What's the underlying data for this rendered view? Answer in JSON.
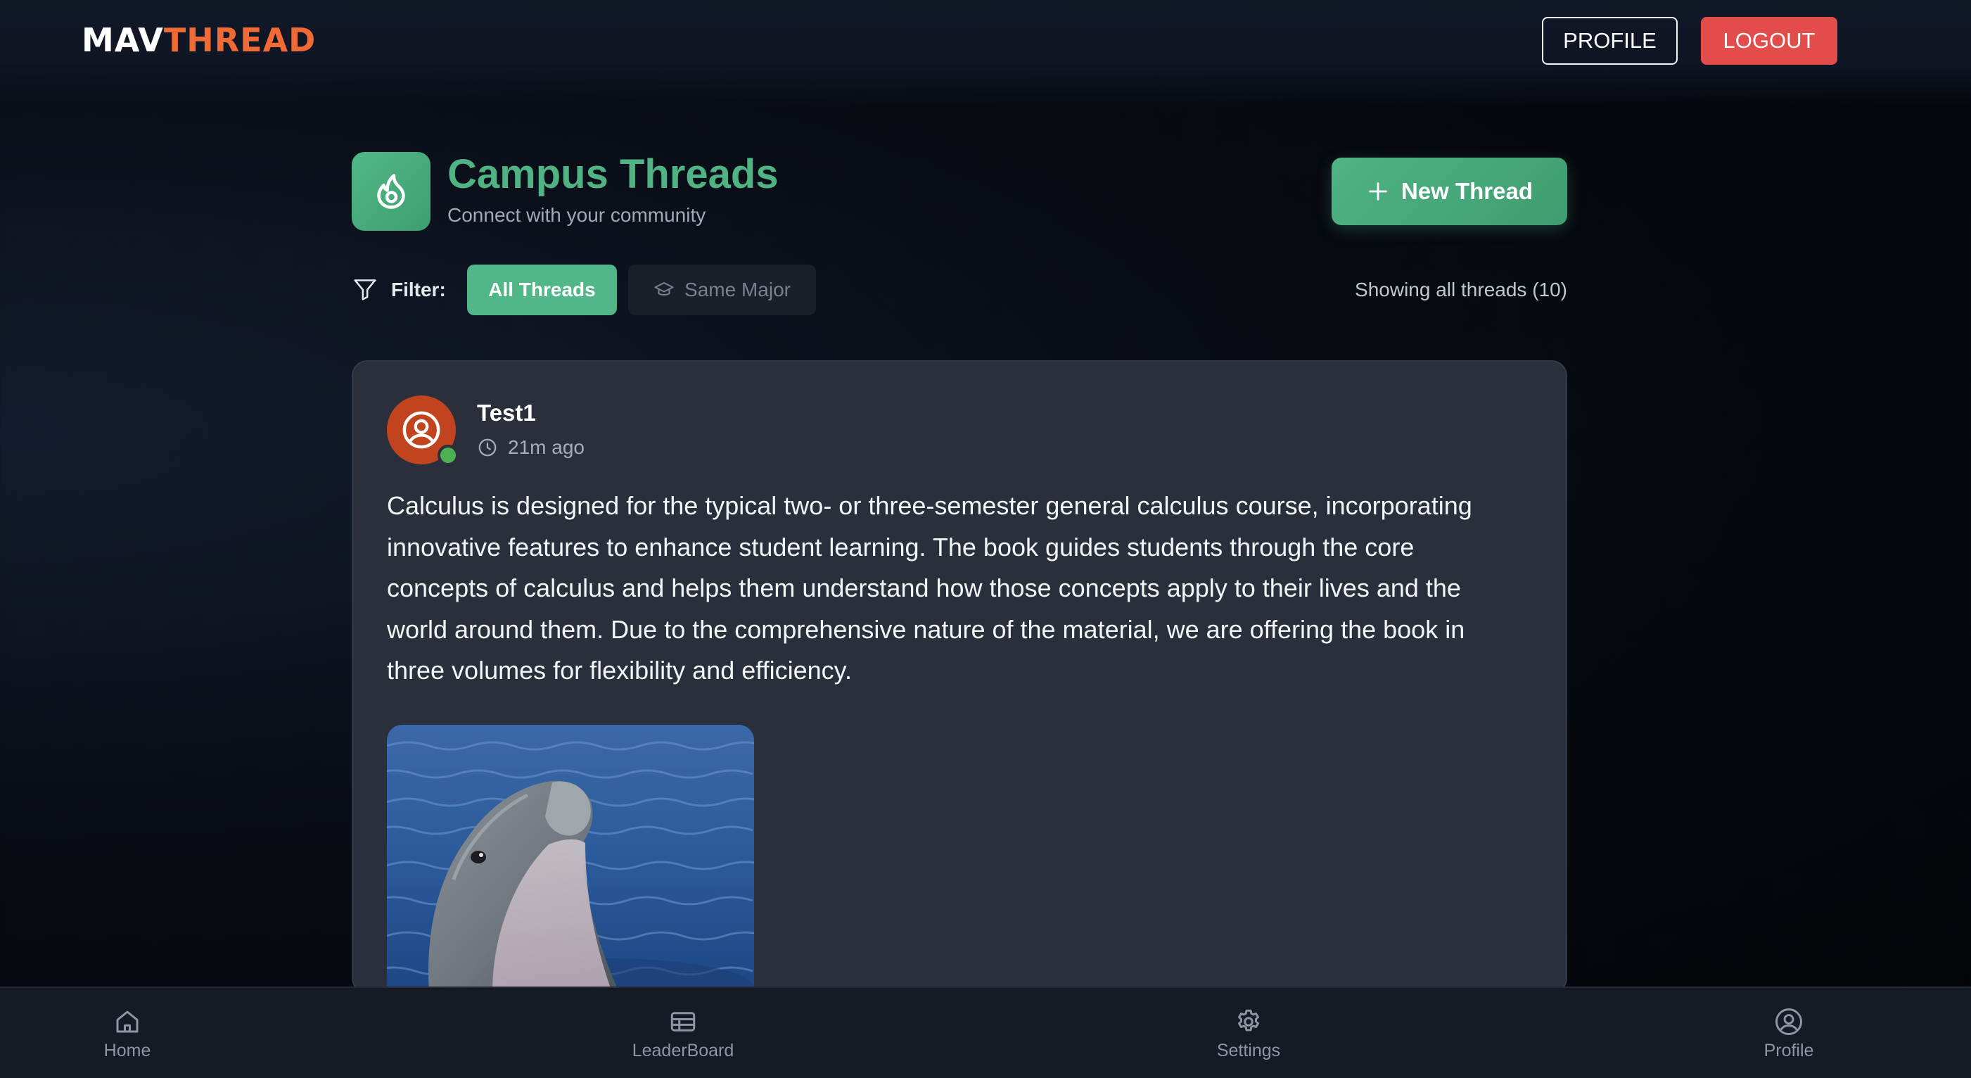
{
  "header": {
    "logo_part1": "MAV",
    "logo_part2": "THREAD",
    "profile_button": "PROFILE",
    "logout_button": "LOGOUT"
  },
  "page": {
    "title": "Campus Threads",
    "subtitle": "Connect with your community",
    "new_thread_button": "New Thread",
    "icon": "flame-icon"
  },
  "filter": {
    "label": "Filter:",
    "options": [
      {
        "label": "All Threads",
        "active": true
      },
      {
        "label": "Same Major",
        "active": false,
        "icon": "graduation-cap-icon"
      }
    ],
    "status_text": "Showing all threads (10)"
  },
  "thread": {
    "author": "Test1",
    "time": "21m ago",
    "online": true,
    "body": "Calculus is designed for the typical two- or three-semester general calculus course, incorporating innovative features to enhance student learning. The book guides students through the core concepts of calculus and helps them understand how those concepts apply to their lives and the world around them. Due to the comprehensive nature of the material, we are offering the book in three volumes for flexibility and efficiency.",
    "image": "dolphin-photo"
  },
  "bottom_nav": [
    {
      "label": "Home",
      "icon": "home-icon"
    },
    {
      "label": "LeaderBoard",
      "icon": "leaderboard-icon"
    },
    {
      "label": "Settings",
      "icon": "gear-icon"
    },
    {
      "label": "Profile",
      "icon": "user-circle-icon"
    }
  ],
  "colors": {
    "accent_green": "#52b788",
    "logo_orange": "#ef6a34",
    "logout_red": "#e24c4b",
    "avatar_orange": "#c2441f",
    "online_green": "#4caf50"
  }
}
